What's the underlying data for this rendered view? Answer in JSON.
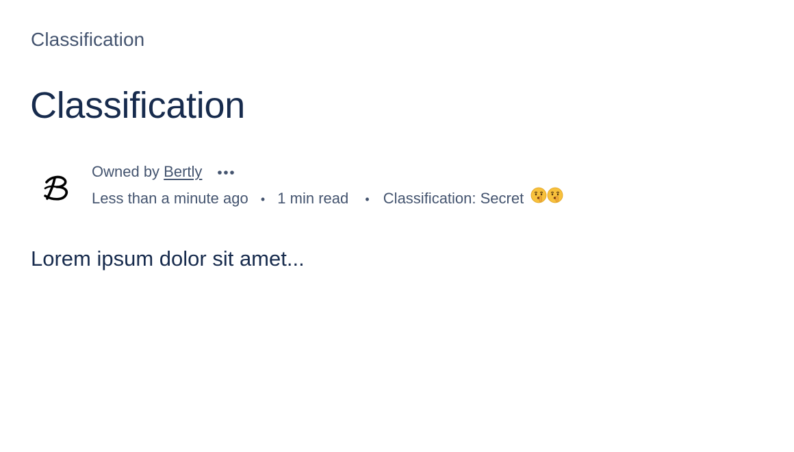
{
  "breadcrumb": {
    "label": "Classification"
  },
  "page": {
    "title": "Classification",
    "body": "Lorem ipsum dolor sit amet..."
  },
  "byline": {
    "owned_by_prefix": "Owned by ",
    "owner_name": "Bertly",
    "avatar_initial": "B",
    "updated": "Less than a minute ago",
    "read_time": "1 min read",
    "classification": "Classification: Secret",
    "separator": "•",
    "emoji_icon": "shushing-face-icon"
  },
  "colors": {
    "title": "#172b4d",
    "subtle_text": "#44546f",
    "background": "#ffffff"
  }
}
